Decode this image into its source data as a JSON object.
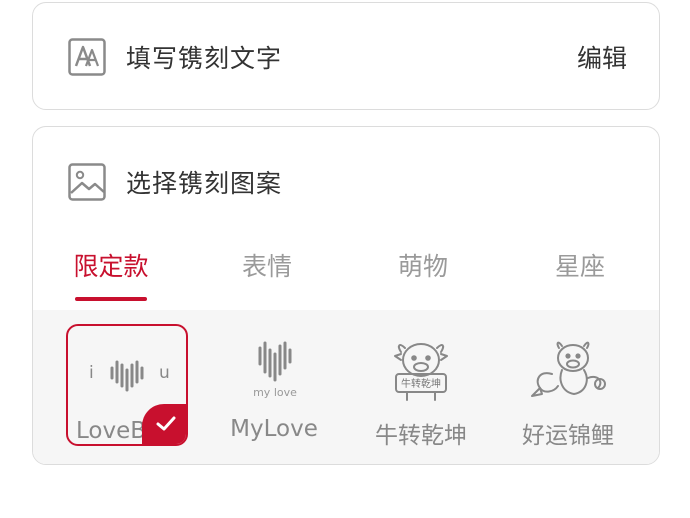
{
  "engrave_text": {
    "icon": "text-font-icon",
    "title": "填写镌刻文字",
    "action_label": "编辑"
  },
  "engrave_pattern": {
    "icon": "image-icon",
    "title": "选择镌刻图案",
    "tabs": [
      {
        "label": "限定款",
        "active": true
      },
      {
        "label": "表情",
        "active": false
      },
      {
        "label": "萌物",
        "active": false
      },
      {
        "label": "星座",
        "active": false
      }
    ],
    "patterns": [
      {
        "label": "LoveB",
        "icon": "love-soundwave-icon",
        "left_char": "i",
        "right_char": "u",
        "selected": true
      },
      {
        "label": "MyLove",
        "icon": "mylove-soundwave-icon",
        "caption": "my love",
        "selected": false
      },
      {
        "label": "牛转乾坤",
        "icon": "ox-sign-icon",
        "sign_text": "牛转乾坤",
        "selected": false
      },
      {
        "label": "好运锦鲤",
        "icon": "ox-koi-icon",
        "selected": false
      }
    ]
  },
  "colors": {
    "accent": "#c8102e",
    "border": "#dcdcdc",
    "muted_text": "#9a9a9a",
    "gallery_bg": "#f6f6f6"
  }
}
